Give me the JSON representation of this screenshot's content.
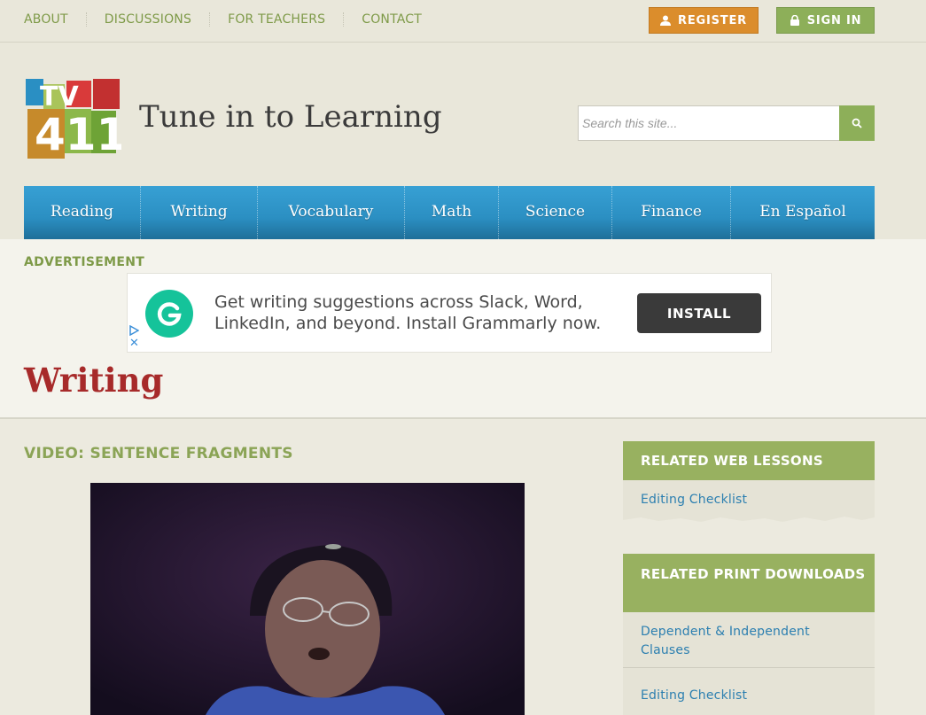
{
  "toplinks": [
    "ABOUT",
    "DISCUSSIONS",
    "FOR TEACHERS",
    "CONTACT"
  ],
  "auth": {
    "register": "REGISTER",
    "signin": "SIGN IN"
  },
  "site": {
    "title": "Tune in to Learning",
    "logo_text": "TV411"
  },
  "search": {
    "placeholder": "Search this site..."
  },
  "nav": [
    "Reading",
    "Writing",
    "Vocabulary",
    "Math",
    "Science",
    "Finance",
    "En Español"
  ],
  "ad": {
    "label": "ADVERTISEMENT",
    "text": "Get writing suggestions across Slack, Word, LinkedIn, and beyond. Install Grammarly now.",
    "button": "INSTALL",
    "close": "✕"
  },
  "page": {
    "title": "Writing",
    "video_heading": "VIDEO: SENTENCE FRAGMENTS"
  },
  "sidebar": {
    "web_lessons": {
      "heading": "RELATED WEB LESSONS",
      "links": [
        "Editing Checklist"
      ]
    },
    "print_downloads": {
      "heading": "RELATED PRINT DOWNLOADS",
      "links": [
        "Dependent & Independent Clauses",
        "Editing Checklist"
      ]
    }
  },
  "colors": {
    "green": "#8daf59",
    "orange": "#db8d2c",
    "blue": "#2b8fc2",
    "title_red": "#a72a2a"
  }
}
